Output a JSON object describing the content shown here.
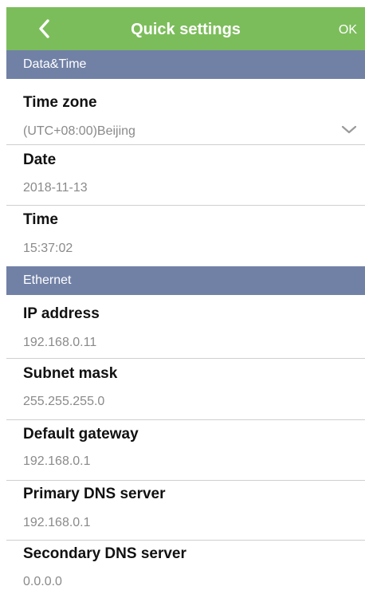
{
  "header": {
    "back_icon": "chevron-left-icon",
    "title": "Quick settings",
    "ok_label": "OK",
    "background_color": "#7cbd5b"
  },
  "sections": {
    "datetime": {
      "title": "Data&Time",
      "rows": {
        "timezone": {
          "label": "Time zone",
          "value": "(UTC+08:00)Beijing",
          "icon": "chevron-down-icon"
        },
        "date": {
          "label": "Date",
          "value": "2018-11-13"
        },
        "time": {
          "label": "Time",
          "value": "15:37:02"
        }
      }
    },
    "ethernet": {
      "title": "Ethernet",
      "rows": {
        "ip": {
          "label": "IP address",
          "value": "192.168.0.11"
        },
        "subnet": {
          "label": "Subnet mask",
          "value": "255.255.255.0"
        },
        "gateway": {
          "label": "Default gateway",
          "value": "192.168.0.1"
        },
        "dns1": {
          "label": "Primary DNS server",
          "value": "192.168.0.1"
        },
        "dns2": {
          "label": "Secondary DNS server",
          "value": "0.0.0.0"
        }
      }
    }
  },
  "colors": {
    "section_header": "#7181a6",
    "value_text": "#8a8a8a",
    "divider": "#cfcfcf"
  }
}
